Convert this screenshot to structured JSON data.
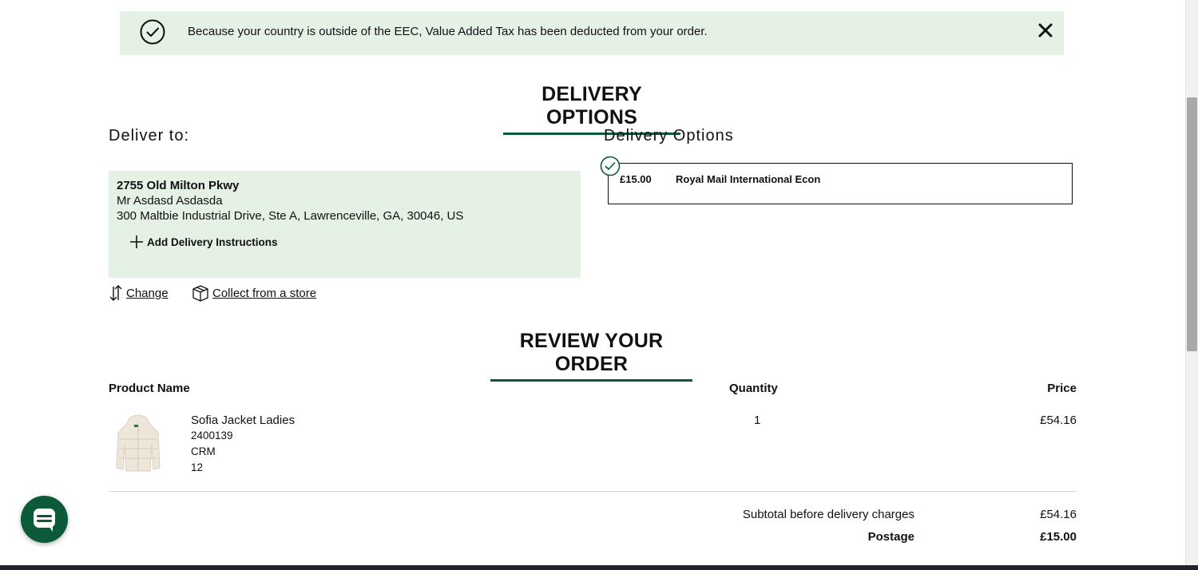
{
  "notice": {
    "message": "Because your country is outside of the EEC, Value Added Tax has been deducted from your order."
  },
  "delivery": {
    "heading": "DELIVERY OPTIONS",
    "deliver_to_label": "Deliver to:",
    "address": {
      "line1": "2755 Old Milton Pkwy",
      "line2": "Mr Asdasd Asdasda",
      "line3": "300 Maltbie Industrial Drive, Ste A, Lawrenceville, GA, 30046, US"
    },
    "add_instructions_label": "Add Delivery Instructions",
    "change_label": "Change",
    "collect_label": "Collect from a store",
    "options_label": "Delivery Options",
    "selected_option": {
      "price": "£15.00",
      "name": "Royal Mail International Econ"
    }
  },
  "review": {
    "heading": "REVIEW YOUR ORDER",
    "columns": {
      "product": "Product Name",
      "quantity": "Quantity",
      "price": "Price"
    },
    "items": [
      {
        "name": "Sofia Jacket Ladies",
        "code": "2400139",
        "colour": "CRM",
        "size": "12",
        "quantity": "1",
        "price": "£54.16"
      }
    ],
    "totals": {
      "subtotal_label": "Subtotal before delivery charges",
      "subtotal_value": "£54.16",
      "postage_label": "Postage",
      "postage_value": "£15.00"
    }
  },
  "colors": {
    "brand_green": "#0b5a3a",
    "notice_bg": "#e6f1e6"
  }
}
